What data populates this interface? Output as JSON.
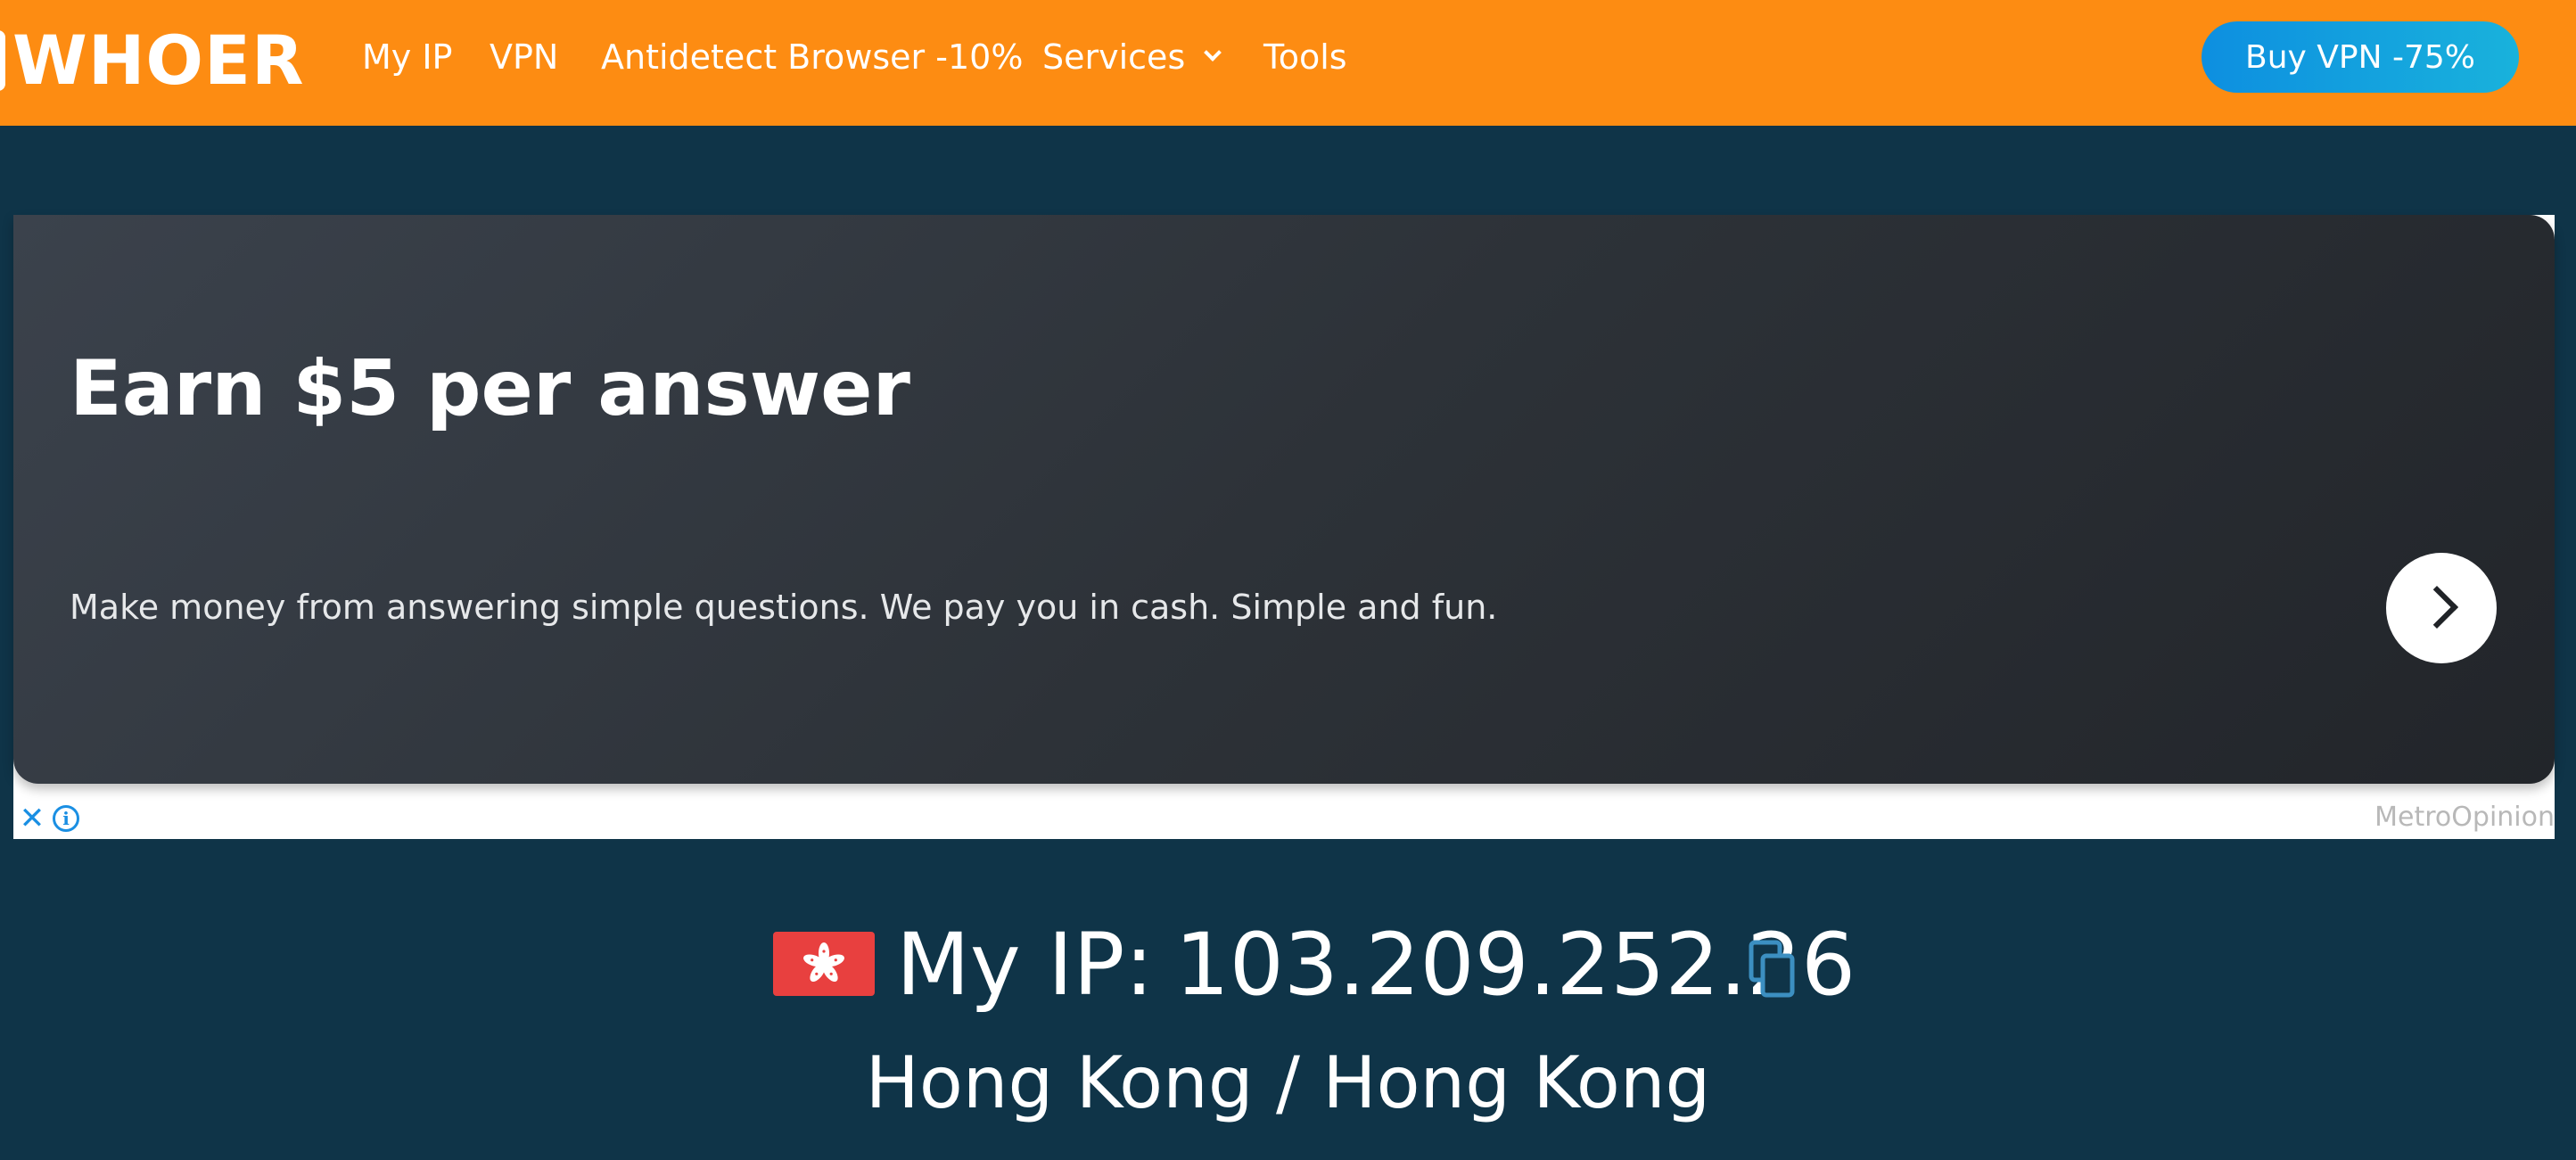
{
  "header": {
    "logo": "WHOER",
    "nav": {
      "my_ip": "My IP",
      "vpn": "VPN",
      "antidetect": "Antidetect Browser -10%",
      "services": "Services",
      "tools": "Tools"
    },
    "buy_button": "Buy VPN -75%",
    "background_color": "#fd8c12",
    "button_color": "#0d8fe0"
  },
  "ad": {
    "title": "Earn $5 per answer",
    "description": "Make money from answering simple questions. We pay you in cash. Simple and fun.",
    "brand": "MetroOpinion",
    "close_icon": "close-icon",
    "info_icon": "info-icon",
    "arrow_icon": "chevron-right-icon"
  },
  "ip_info": {
    "label": "My IP:",
    "ip": "103.209.252.26",
    "location": "Hong Kong / Hong Kong",
    "flag": "hong-kong-flag-icon",
    "copy_icon": "copy-icon"
  },
  "colors": {
    "page_background": "#0f3448",
    "accent_blue": "#1a8fe3",
    "flag_red": "#e8403f"
  }
}
